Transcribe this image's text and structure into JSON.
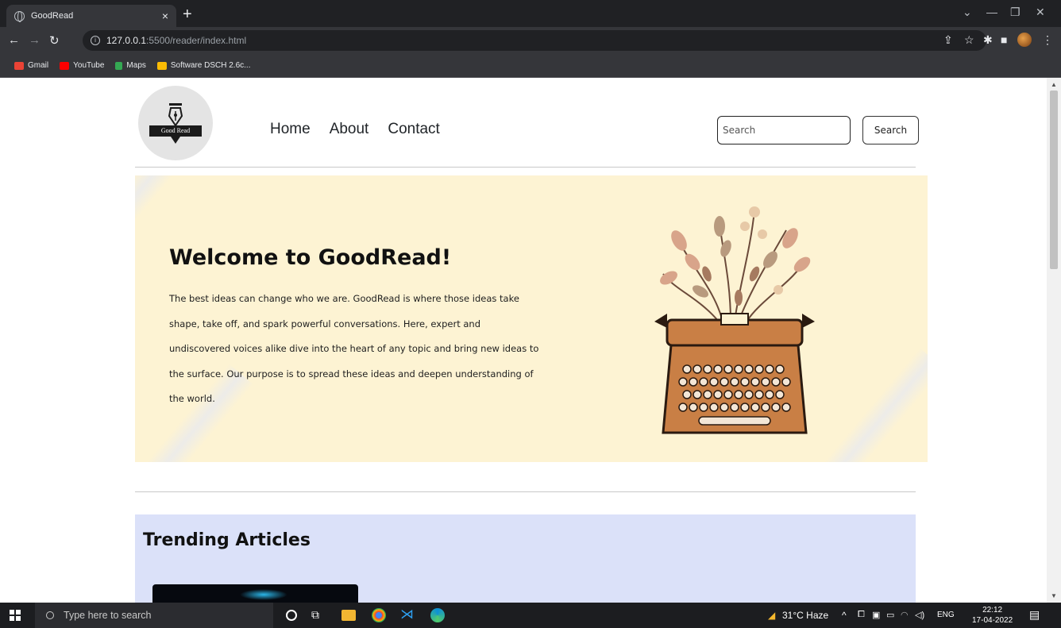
{
  "browser": {
    "tab_title": "GoodRead",
    "tab_close": "×",
    "new_tab": "+",
    "url_host": "127.0.0.1",
    "url_path": ":5500/reader/index.html",
    "bookmarks": [
      {
        "label": "Gmail",
        "color": "#ea4335"
      },
      {
        "label": "YouTube",
        "color": "#ff0000"
      },
      {
        "label": "Maps",
        "color": "#34a853"
      },
      {
        "label": "Software DSCH 2.6c...",
        "color": "#fbbc04"
      }
    ]
  },
  "site": {
    "logo_text": "Good Read",
    "nav": [
      "Home",
      "About",
      "Contact"
    ],
    "search": {
      "placeholder": "Search",
      "button_label": "Search"
    },
    "hero": {
      "title": "Welcome to GoodRead!",
      "text": "The best ideas can change who we are. GoodRead is where those ideas take shape, take off, and spark powerful conversations. Here, expert and undiscovered voices alike dive into the heart of any topic and bring new ideas to the surface. Our purpose is to spread these ideas and deepen understanding of the world."
    },
    "trending_title": "Trending Articles"
  },
  "taskbar": {
    "search_placeholder": "Type here to search",
    "weather": "31°C Haze",
    "language": "ENG",
    "time": "22:12",
    "date": "17-04-2022"
  },
  "colors": {
    "hero_bg": "#fdf3d3",
    "trending_bg": "#dbe1f9",
    "typewriter": "#c97f45"
  }
}
